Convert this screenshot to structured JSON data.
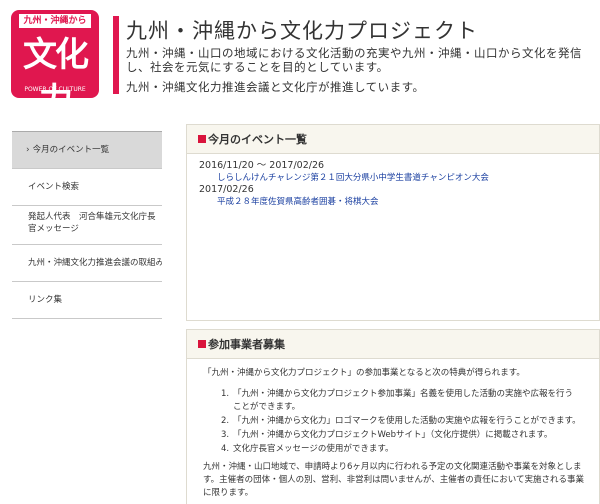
{
  "header": {
    "logo_top": "九州・沖縄から",
    "logo_main": "文化力",
    "logo_sub": "POWER OF CULTURE",
    "title": "九州・沖縄から文化力プロジェクト",
    "description": "九州・沖縄・山口の地域における文化活動の充実や九州・沖縄・山口から文化を発信し、社会を元気にすることを目的としています。",
    "description2": "九州・沖縄文化力推進会議と文化庁が推進しています。",
    "accent_color": "#e0174f"
  },
  "sidebar": {
    "items": [
      {
        "label": "今月のイベント一覧",
        "active": true
      },
      {
        "label": "イベント検索",
        "active": false
      },
      {
        "label": "発起人代表　河合隼雄元文化庁長官メッセージ",
        "active": false
      },
      {
        "label": "九州・沖縄文化力推進会議の取組み",
        "active": false
      },
      {
        "label": "リンク集",
        "active": false
      }
    ],
    "arrow_icon": "chevron-right-icon"
  },
  "events": {
    "heading": "今月のイベント一覧",
    "items": [
      {
        "date": "2016/11/20 〜 2017/02/26",
        "title": "しらしんけんチャレンジ第２１回大分県小中学生書道チャンピオン大会"
      },
      {
        "date": "2017/02/26",
        "title": "平成２８年度佐賀県高齢者囲碁・将棋大会"
      }
    ]
  },
  "partners": {
    "heading": "参加事業者募集",
    "intro": "「九州・沖縄から文化力プロジェクト」の参加事業となると次の特典が得られます。",
    "benefits": [
      {
        "num": "1.",
        "text": "「九州・沖縄から文化力プロジェクト参加事業」名義を使用した活動の実施や広報を行うことができます。"
      },
      {
        "num": "2.",
        "text": "「九州・沖縄から文化力」ロゴマークを使用した活動の実施や広報を行うことができます。"
      },
      {
        "num": "3.",
        "text": "「九州・沖縄から文化力プロジェクトWebサイト」（文化庁提供）に掲載されます。"
      },
      {
        "num": "4.",
        "text": "文化庁長官メッセージの使用ができます。"
      }
    ],
    "note": "九州・沖縄・山口地域で、申請時より6ヶ月以内に行われる予定の文化関連活動や事業を対象とします。主催者の団体・個人の別、営利、非営利は問いませんが、主催者の責任において実施される事業に限ります。"
  }
}
